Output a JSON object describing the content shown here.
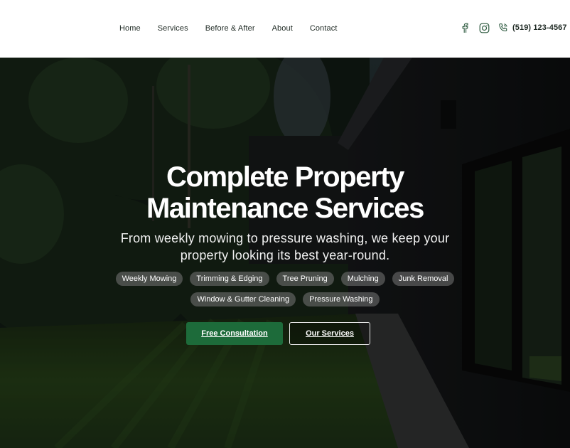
{
  "nav": {
    "items": [
      "Home",
      "Services",
      "Before & After",
      "About",
      "Contact"
    ]
  },
  "social": {
    "icons": [
      "facebook-icon",
      "instagram-icon",
      "phone-icon"
    ],
    "phone": "(519) 123-4567"
  },
  "hero": {
    "title_line1": "Complete Property",
    "title_line2": "Maintenance Services",
    "subtitle_line1": "From weekly mowing to pressure washing, we keep your",
    "subtitle_line2": "property looking its best year-round.",
    "services_row1": [
      "Weekly Mowing",
      "Trimming & Edging",
      "Tree Pruning",
      "Mulching",
      "Junk Removal"
    ],
    "services_row2": [
      "Window & Gutter Cleaning",
      "Pressure Washing"
    ],
    "primary_cta": "Free Consultation",
    "secondary_cta": "Our Services"
  },
  "colors": {
    "accent_green": "#1d6b3a",
    "text_dark": "#1f2a24",
    "chip_bg": "rgba(120,120,120,0.55)"
  }
}
